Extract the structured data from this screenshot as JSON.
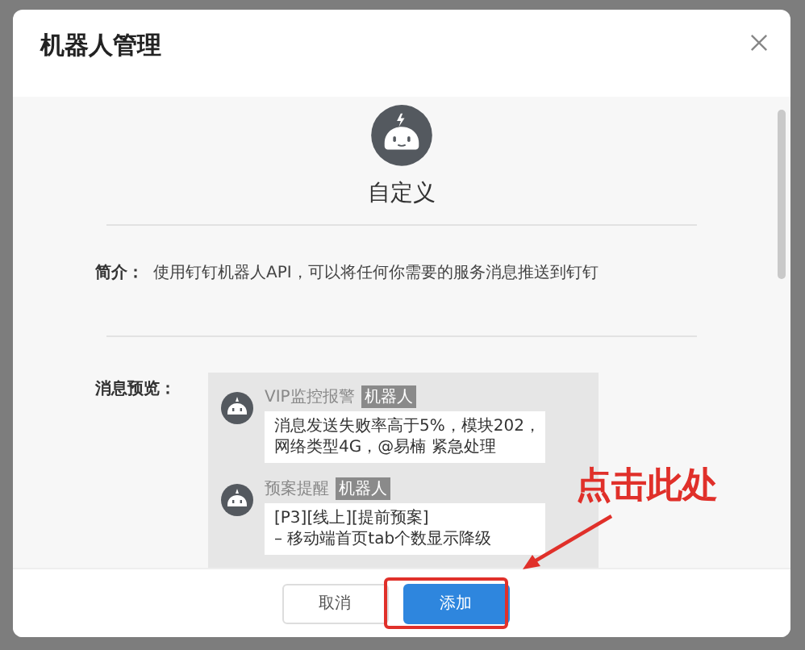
{
  "dialog": {
    "title": "机器人管理"
  },
  "robot": {
    "name": "自定义"
  },
  "intro": {
    "label": "简介：",
    "text": "使用钉钉机器人API，可以将任何你需要的服务消息推送到钉钉"
  },
  "preview": {
    "label": "消息预览：",
    "messages": [
      {
        "sender": "VIP监控报警",
        "tag": "机器人",
        "lines": [
          "消息发送失败率高于5%，模块202，",
          "网络类型4G，@易楠 紧急处理"
        ]
      },
      {
        "sender": "预案提醒",
        "tag": "机器人",
        "lines": [
          "[P3][线上][提前预案]",
          "– 移动端首页tab个数显示降级"
        ]
      }
    ]
  },
  "buttons": [
    {
      "label": "取消",
      "kind": "default"
    },
    {
      "label": "添加",
      "kind": "primary"
    }
  ],
  "annotation": {
    "text": "点击此处"
  }
}
